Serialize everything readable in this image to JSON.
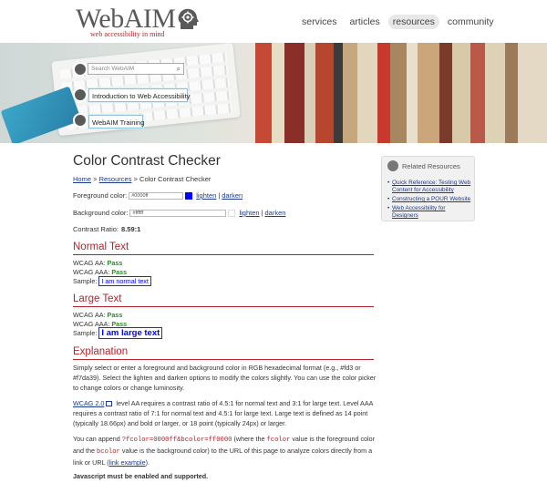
{
  "brand": {
    "logo": "WebAIM",
    "tagline": "web accessibility in mind"
  },
  "nav": [
    {
      "label": "services",
      "active": false
    },
    {
      "label": "articles",
      "active": false
    },
    {
      "label": "resources",
      "active": true
    },
    {
      "label": "community",
      "active": false
    }
  ],
  "banner": {
    "search_placeholder": "Search WebAIM",
    "link_intro": "Introduction to Web Accessibility",
    "link_training": "WebAIM Training"
  },
  "page": {
    "title": "Color Contrast Checker",
    "breadcrumb": {
      "home": "Home",
      "sep1": ">",
      "resources": "Resources",
      "sep2": ">",
      "current": "Color Contrast Checker"
    }
  },
  "checker": {
    "fg_label": "Foreground color:",
    "fg_value": "#0000ff",
    "fg_color": "#0000ff",
    "bg_label": "Background color:",
    "bg_value": "#ffffff",
    "bg_color": "#ffffff",
    "lighten": "lighten",
    "divider": "|",
    "darken": "darken",
    "ratio_label": "Contrast Ratio:",
    "ratio_value": "8.59:1"
  },
  "normal_text": {
    "heading": "Normal Text",
    "aa_label": "WCAG AA:",
    "aa_value": "Pass",
    "aaa_label": "WCAG AAA:",
    "aaa_value": "Pass",
    "sample_label": "Sample:",
    "sample": "I am normal text"
  },
  "large_text": {
    "heading": "Large Text",
    "aa_label": "WCAG AA:",
    "aa_value": "Pass",
    "aaa_label": "WCAG AAA:",
    "aaa_value": "Pass",
    "sample_label": "Sample:",
    "sample": "I am large text"
  },
  "explanation": {
    "heading": "Explanation",
    "p1": "Simply select or enter a foreground and background color in RGB hexadecimal format (e.g., #fd3 or #f7da39). Select the lighten and darken options to modify the colors slightly. You can use the color picker to change colors or change luminosity.",
    "p2_link": "WCAG 2.0",
    "p2": " level AA requires a contrast ratio of 4.5:1 for normal text and 3:1 for large text. Level AAA requires a contrast ratio of 7:1 for normal text and 4.5:1 for large text. Large text is defined as 14 point (typically 18.66px) and bold or larger, or 18 point (typically 24px) or larger.",
    "p3_a": "You can append ",
    "p3_code1": "?fcolor=0000ff&bcolor=ff0000",
    "p3_b": " (where the ",
    "p3_code2": "fcolor",
    "p3_c": " value is the foreground color and the ",
    "p3_code3": "bcolor",
    "p3_d": " value is the background color) to the URL of this page to analyze colors directly from a link or URL (",
    "p3_link": "link example",
    "p3_e": ").",
    "p4": "Javascript must be enabled and supported."
  },
  "related": {
    "title": "Related Resources",
    "items": [
      "Quick Reference: Testing Web Content for Accessibility",
      "Constructing a POUR Website",
      "Web Accessibility for Designers"
    ]
  }
}
